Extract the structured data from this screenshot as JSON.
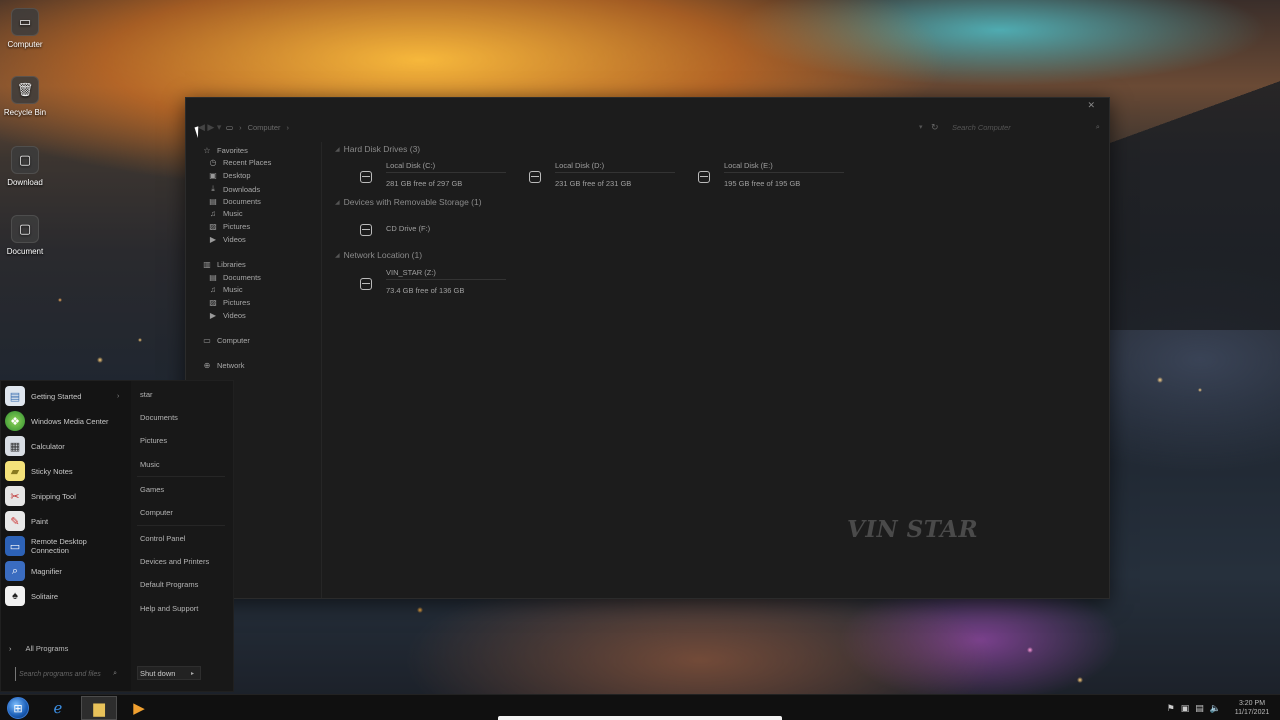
{
  "desktop": {
    "icons": [
      {
        "label": "Computer",
        "icon": "monitor-icon"
      },
      {
        "label": "Recycle Bin",
        "icon": "trash-icon"
      },
      {
        "label": "Download",
        "icon": "folder-icon"
      },
      {
        "label": "Document",
        "icon": "folder-icon"
      }
    ]
  },
  "explorer": {
    "address": {
      "crumb": "Computer",
      "search_placeholder": "Search Computer"
    },
    "nav": {
      "favorites": "Favorites",
      "favorites_items": [
        "Recent Places",
        "Desktop",
        "Downloads",
        "Documents",
        "Music",
        "Pictures",
        "Videos"
      ],
      "libraries": "Libraries",
      "libraries_items": [
        "Documents",
        "Music",
        "Pictures",
        "Videos"
      ],
      "computer": "Computer",
      "network": "Network"
    },
    "groups": {
      "hdd": "Hard Disk Drives (3)",
      "removable": "Devices with Removable Storage (1)",
      "network": "Network Location (1)"
    },
    "drives": [
      {
        "name": "Local Disk (C:)",
        "free": "281 GB free of 297 GB"
      },
      {
        "name": "Local Disk (D:)",
        "free": "231 GB free of 231 GB"
      },
      {
        "name": "Local Disk (E:)",
        "free": "195 GB free of 195 GB"
      },
      {
        "name": "CD Drive (F:)",
        "free": ""
      },
      {
        "name": "VIN_STAR  (Z:)",
        "free": "73.4 GB free of 136 GB"
      }
    ],
    "watermark": "VIN STAR"
  },
  "start_menu": {
    "programs": [
      {
        "label": "Getting Started",
        "icon": "getting-started-icon"
      },
      {
        "label": "Windows Media Center",
        "icon": "media-center-icon"
      },
      {
        "label": "Calculator",
        "icon": "calculator-icon"
      },
      {
        "label": "Sticky Notes",
        "icon": "sticky-notes-icon"
      },
      {
        "label": "Snipping Tool",
        "icon": "scissors-icon"
      },
      {
        "label": "Paint",
        "icon": "paint-icon"
      },
      {
        "label": "Remote Desktop Connection",
        "icon": "remote-desktop-icon"
      },
      {
        "label": "Magnifier",
        "icon": "magnifier-icon"
      },
      {
        "label": "Solitaire",
        "icon": "cards-icon"
      }
    ],
    "all_programs": "All Programs",
    "search_placeholder": "Search programs and files",
    "right_links": [
      "star",
      "Documents",
      "Pictures",
      "Music",
      "Games",
      "Computer",
      "Control Panel",
      "Devices and Printers",
      "Default Programs",
      "Help and Support"
    ],
    "shutdown": "Shut down"
  },
  "taskbar": {
    "time": "3:20 PM",
    "date": "11/17/2021"
  }
}
